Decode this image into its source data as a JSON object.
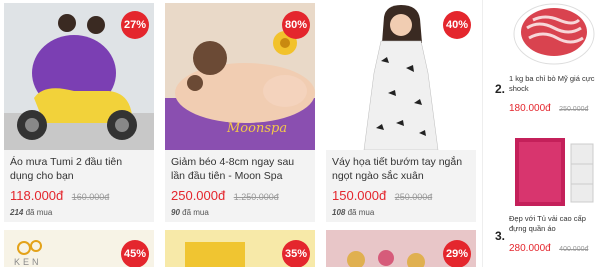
{
  "deals": [
    {
      "title": "Áo mưa Tumi 2 đầu tiên dụng cho bạn",
      "price": "118.000đ",
      "old_price": "160.000đ",
      "sold_count": "214",
      "sold_label": "đã mua",
      "discount": "27%"
    },
    {
      "title": "Giảm béo 4-8cm ngay sau lần đầu tiên - Moon Spa",
      "price": "250.000đ",
      "old_price": "1.250.000đ",
      "sold_count": "90",
      "sold_label": "đã mua",
      "discount": "80%",
      "logo_text": "Moonspa"
    },
    {
      "title": "Váy họa tiết bướm tay ngắn ngọt ngào sắc xuân",
      "price": "150.000đ",
      "old_price": "250.000đ",
      "sold_count": "108",
      "sold_label": "đã mua",
      "discount": "40%"
    }
  ],
  "deals_row2": [
    {
      "discount": "45%",
      "logo_text": "KEN"
    },
    {
      "discount": "35%"
    },
    {
      "discount": "29%"
    }
  ],
  "sidebar": {
    "items": [
      {
        "rank": "2.",
        "title": "1 kg ba chỉ bò Mỹ giá cực shock",
        "price": "180.000đ",
        "old_price": "250.000đ"
      },
      {
        "rank": "3.",
        "title": "Đẹp với Tủ vải cao cấp đựng quần áo",
        "price": "280.000đ",
        "old_price": "400.000đ"
      }
    ]
  },
  "colors": {
    "accent": "#e4262d",
    "card_bg": "#f3f3f3"
  }
}
